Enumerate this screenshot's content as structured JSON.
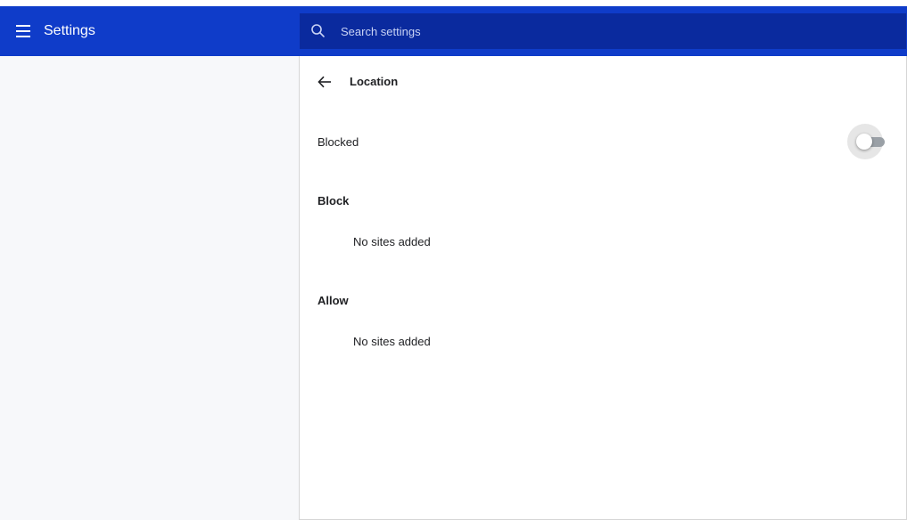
{
  "header": {
    "title": "Settings",
    "search_placeholder": "Search settings"
  },
  "page": {
    "title": "Location"
  },
  "toggle_row": {
    "label": "Blocked",
    "state": "off"
  },
  "sections": {
    "block": {
      "title": "Block",
      "empty_text": "No sites added"
    },
    "allow": {
      "title": "Allow",
      "empty_text": "No sites added"
    }
  },
  "colors": {
    "toolbar": "#0f3cc9",
    "searchbox": "#0a2a9e",
    "sidebar": "#f7f8fa"
  },
  "icons": {
    "menu": "hamburger-menu-icon",
    "search": "search-icon",
    "back": "back-arrow-icon"
  }
}
